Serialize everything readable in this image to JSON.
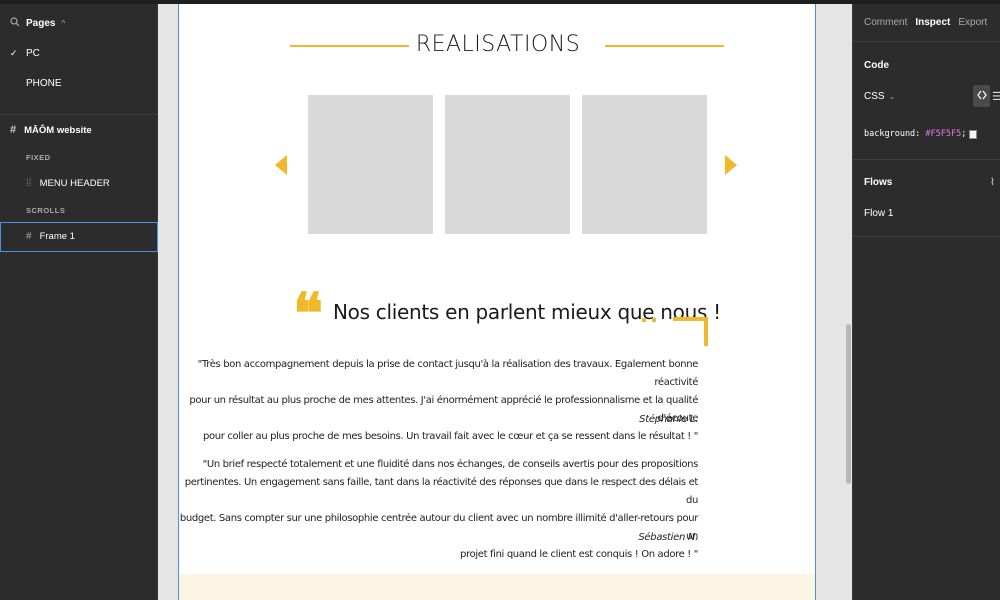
{
  "left_panel": {
    "pages_label": "Pages",
    "pages_caret": "^",
    "pages": [
      {
        "label": "PC",
        "selected": true,
        "check": "✓"
      },
      {
        "label": "PHONE",
        "selected": false,
        "check": ""
      }
    ],
    "file_name": "MĀÔM website",
    "fixed_label": "FIXED",
    "fixed_layer": "MENU HEADER",
    "scrolls_label": "SCROLLS",
    "scroll_layer": "Frame 1"
  },
  "frame": {
    "section_title": "REALISATIONS",
    "quote_mark": "❝",
    "quote_title": "Nos clients en parlent mieux que nous !",
    "testimonials": [
      {
        "lines": [
          "\"Très bon accompagnement depuis la prise de contact jusqu'à la réalisation des travaux. Egalement bonne réactivité",
          "pour un résultat au plus proche de mes attentes. J'ai énormément apprécié le professionnalisme et la qualité d'écoute",
          "pour coller au plus proche de mes besoins. Un travail fait avec le cœur et ça se ressent dans le résultat ! \""
        ],
        "author": "Stéphanie L."
      },
      {
        "lines": [
          "\"Un brief respecté totalement et une fluidité dans nos échanges, de conseils avertis pour des propositions",
          "pertinentes. Un engagement sans faille, tant dans la réactivité des réponses que dans le respect des délais et du",
          "budget. Sans compter sur une philosophie centrée autour du client avec un nombre illimité d'aller-retours pour un",
          "projet fini quand le client est conquis ! On adore ! \""
        ],
        "author": "Sébastien N."
      }
    ],
    "colors": {
      "accent": "#F0B82A",
      "thumb": "#D9D9D9",
      "footer_band": "#FCF5E4"
    }
  },
  "right_panel": {
    "tabs": [
      "Comment",
      "Inspect",
      "Export"
    ],
    "active_tab": "Inspect",
    "code_heading": "Code",
    "language": "CSS",
    "language_caret": "⌄",
    "code_prop": "background:",
    "code_value": "#F5F5F5",
    "code_end": ";",
    "flows_heading": "Flows",
    "flow_item": "Flow 1",
    "icons": {
      "code": "code-brackets-icon",
      "list": "list-icon",
      "flows": "flows-icon"
    }
  }
}
